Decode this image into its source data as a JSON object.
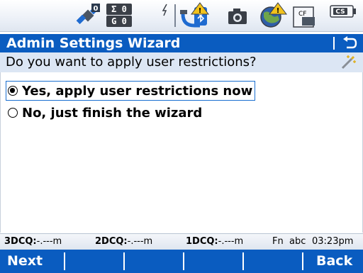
{
  "status_bar": {
    "satellite_counts": [
      "0",
      "0"
    ],
    "satellite_systems": [
      "Σ",
      "G"
    ],
    "icons": [
      "satellite-icon",
      "satellite-count-box",
      "lightning-icon",
      "bluetooth-warning-icon",
      "camera-icon",
      "globe-warning-icon",
      "cf-card-icon",
      "battery-cs-icon"
    ],
    "cf_label": "CF",
    "battery_label": "CS"
  },
  "titlebar": {
    "title": "Admin Settings Wizard"
  },
  "question": {
    "text": "Do you want to apply user restrictions?"
  },
  "options": [
    {
      "label": "Yes, apply user restrictions now",
      "selected": true
    },
    {
      "label": "No, just finish the wizard",
      "selected": false
    }
  ],
  "quality_bar": {
    "cq3_label": "3DCQ:",
    "cq3_value": "-.---m",
    "cq2_label": "2DCQ:",
    "cq2_value": "-.---m",
    "cq1_label": "1DCQ:",
    "cq1_value": "-.---m",
    "fn": "Fn",
    "input_mode": "abc",
    "time": "03:23pm"
  },
  "softkeys": {
    "left": "Next",
    "right": "Back"
  },
  "colors": {
    "accent": "#0a5cc0",
    "question_bg": "#dce6f4",
    "status_bg": "#e9eef6"
  }
}
